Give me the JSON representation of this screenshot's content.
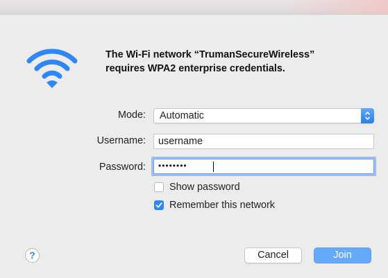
{
  "dialog": {
    "message": "The Wi-Fi network “TrumanSecureWireless” requires WPA2 enterprise credentials.",
    "icon": "wifi-icon",
    "accent_color": "#2f86f6"
  },
  "form": {
    "mode_label": "Mode:",
    "mode_value": "Automatic",
    "username_label": "Username:",
    "username_value": "username",
    "password_label": "Password:",
    "password_masked": "••••••••"
  },
  "options": {
    "show_password_label": "Show password",
    "show_password_checked": false,
    "remember_label": "Remember this network",
    "remember_checked": true
  },
  "buttons": {
    "help_label": "?",
    "cancel_label": "Cancel",
    "join_label": "Join"
  }
}
